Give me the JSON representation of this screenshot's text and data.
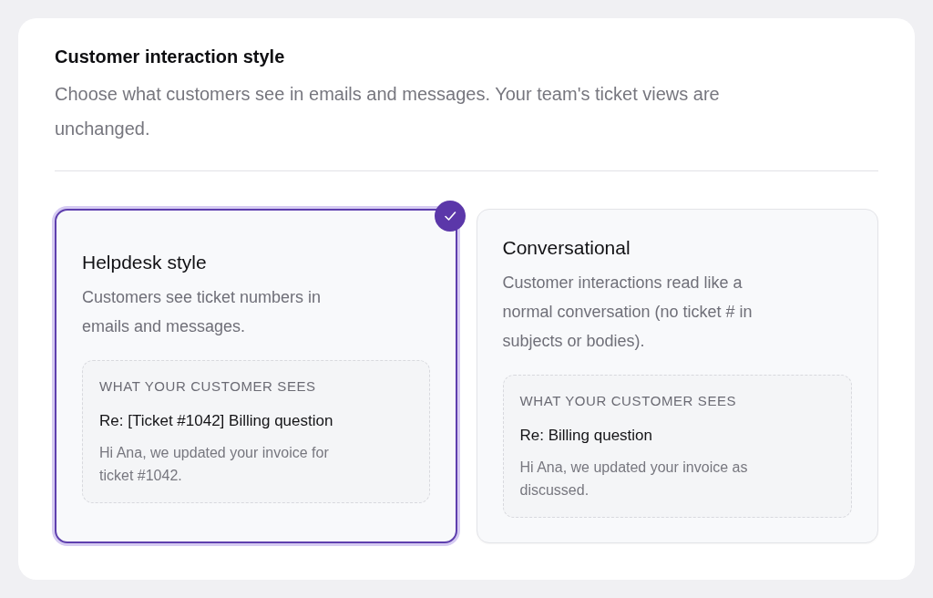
{
  "section": {
    "title": "Customer interaction style",
    "description": "Choose what customers see in emails and messages. Your team's ticket views are unchanged."
  },
  "options": [
    {
      "title": "Helpdesk style",
      "description": "Customers see ticket numbers in emails and messages.",
      "selected": true,
      "preview": {
        "label": "WHAT YOUR CUSTOMER SEES",
        "subject": "Re: [Ticket #1042] Billing question",
        "body": "Hi Ana, we updated your invoice for ticket #1042."
      }
    },
    {
      "title": "Conversational",
      "description": "Customer interactions read like a normal conversation (no ticket # in subjects or bodies).",
      "selected": false,
      "preview": {
        "label": "WHAT YOUR CUSTOMER SEES",
        "subject": "Re: Billing question",
        "body": "Hi Ana, we updated your invoice as discussed."
      }
    }
  ]
}
